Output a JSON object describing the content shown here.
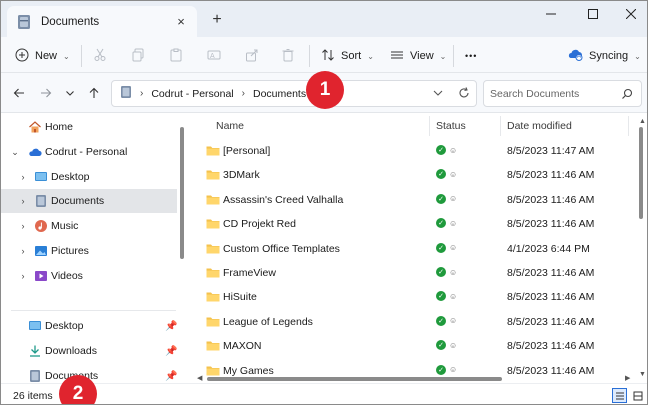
{
  "window": {
    "tab_title": "Documents",
    "tab_close": "×",
    "new_tab": "+",
    "minimize": "—",
    "maximize": "☐",
    "close": "✕"
  },
  "toolbar": {
    "new_label": "New",
    "sort_label": "Sort",
    "view_label": "View",
    "more_label": "•••",
    "sync_label": "Syncing"
  },
  "address": {
    "crumbs": [
      "Codrut - Personal",
      "Documents"
    ],
    "search_placeholder": "Search Documents"
  },
  "nav": {
    "items": [
      {
        "label": "Home"
      },
      {
        "label": "Codrut - Personal"
      },
      {
        "label": "Desktop"
      },
      {
        "label": "Documents"
      },
      {
        "label": "Music"
      },
      {
        "label": "Pictures"
      },
      {
        "label": "Videos"
      }
    ],
    "quick": [
      {
        "label": "Desktop"
      },
      {
        "label": "Downloads"
      },
      {
        "label": "Documents"
      }
    ]
  },
  "columns": {
    "name": "Name",
    "status": "Status",
    "date": "Date modified"
  },
  "files": [
    {
      "name": "[Personal]",
      "date": "8/5/2023 11:47 AM"
    },
    {
      "name": "3DMark",
      "date": "8/5/2023 11:46 AM"
    },
    {
      "name": "Assassin's Creed Valhalla",
      "date": "8/5/2023 11:46 AM"
    },
    {
      "name": "CD Projekt Red",
      "date": "8/5/2023 11:46 AM"
    },
    {
      "name": "Custom Office Templates",
      "date": "4/1/2023 6:44 PM"
    },
    {
      "name": "FrameView",
      "date": "8/5/2023 11:46 AM"
    },
    {
      "name": "HiSuite",
      "date": "8/5/2023 11:46 AM"
    },
    {
      "name": "League of Legends",
      "date": "8/5/2023 11:46 AM"
    },
    {
      "name": "MAXON",
      "date": "8/5/2023 11:46 AM"
    },
    {
      "name": "My Games",
      "date": "8/5/2023 11:46 AM"
    }
  ],
  "status": {
    "count": "26 items"
  },
  "annotations": {
    "one": "1",
    "two": "2"
  },
  "colors": {
    "accent": "#2a6fd6",
    "badge": "#e0242e",
    "folder": "#f4c24d",
    "sync_ok": "#1f9a3c"
  }
}
